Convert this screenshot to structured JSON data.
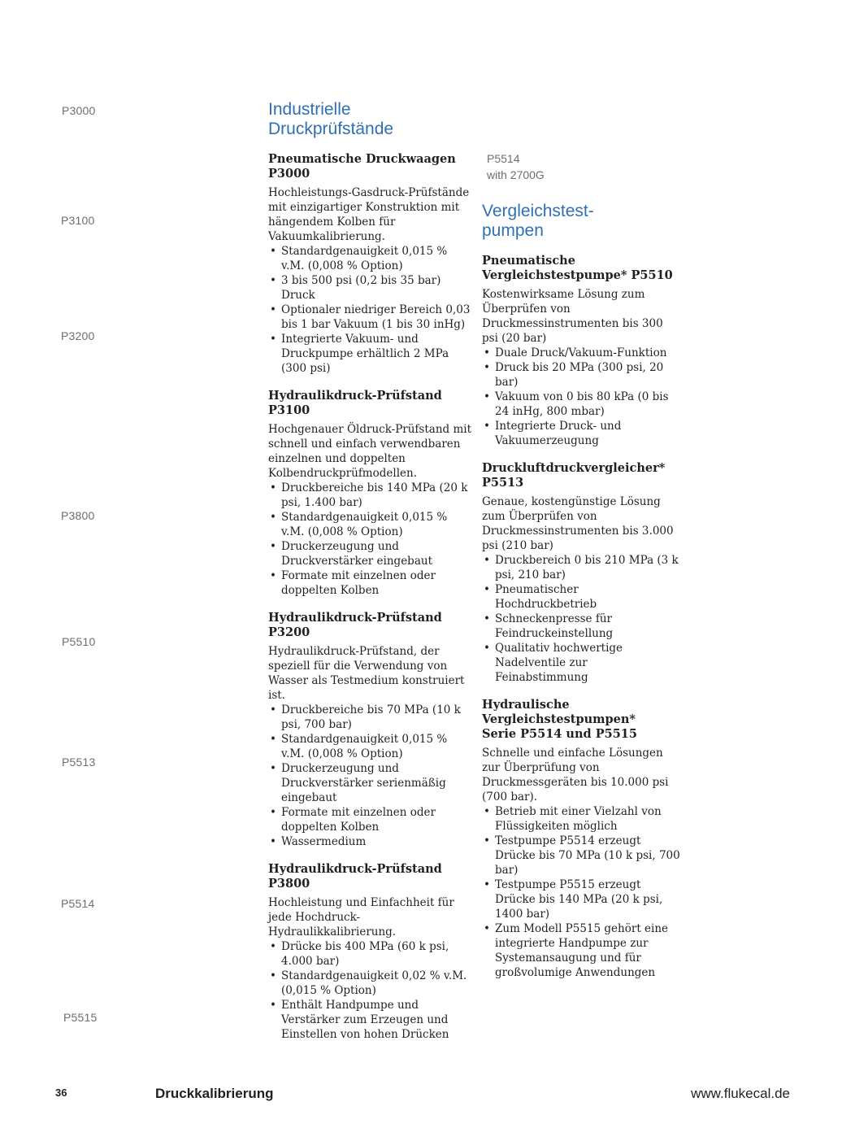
{
  "side_captions": [
    "P3000",
    "P3100",
    "P3200",
    "P3800",
    "P5510",
    "P5513",
    "P5514",
    "P5515"
  ],
  "mid_caption": {
    "line1": "P5514",
    "line2": "with 2700G"
  },
  "section1": {
    "title_line1": "Industrielle",
    "title_line2": "Druckprüfstände",
    "products": [
      {
        "name_line1": "Pneumatische Druckwaagen",
        "name_line2": "P3000",
        "desc": "Hochleistungs-Gasdruck-Prüfstände mit einzigartiger Konstruktion mit hängendem Kolben für Vakuumkalibrierung.",
        "bullets": [
          "Standardgenauigkeit 0,015 % v.M. (0,008 % Option)",
          "3 bis 500 psi (0,2 bis 35 bar) Druck",
          "Optionaler niedriger Bereich 0,03 bis 1 bar Vakuum (1 bis 30 inHg)",
          "Integrierte Vakuum- und Druckpumpe erhältlich 2 MPa (300 psi)"
        ]
      },
      {
        "name_line1": "Hydraulikdruck-Prüfstand",
        "name_line2": "P3100",
        "desc": "Hochgenauer Öldruck-Prüfstand mit schnell und einfach verwendbaren einzelnen und doppelten Kolbendruckprüfmodellen.",
        "bullets": [
          "Druckbereiche bis 140 MPa (20 k psi, 1.400 bar)",
          "Standardgenauigkeit 0,015 % v.M. (0,008 % Option)",
          "Druckerzeugung und Druckverstärker eingebaut",
          "Formate mit einzelnen oder doppelten Kolben"
        ]
      },
      {
        "name_line1": "Hydraulikdruck-Prüfstand",
        "name_line2": "P3200",
        "desc": "Hydraulikdruck-Prüfstand, der speziell für die Verwendung von Wasser als Testmedium konstruiert ist.",
        "bullets": [
          "Druckbereiche bis 70 MPa (10 k psi, 700 bar)",
          "Standardgenauigkeit 0,015 % v.M. (0,008 % Option)",
          "Druckerzeugung und Druckverstärker serienmäßig eingebaut",
          "Formate mit einzelnen oder doppelten Kolben",
          "Wassermedium"
        ]
      },
      {
        "name_line1": "Hydraulikdruck-Prüfstand",
        "name_line2": "P3800",
        "desc": "Hochleistung und Einfachheit für jede Hochdruck-Hydraulikkalibrierung.",
        "bullets": [
          "Drücke bis 400 MPa (60 k psi, 4.000 bar)",
          "Standardgenauigkeit 0,02 % v.M. (0,015 % Option)",
          "Enthält Handpumpe und Verstärker zum Erzeugen und Einstellen von hohen Drücken"
        ]
      }
    ]
  },
  "section2": {
    "title_line1": "Vergleichstest-",
    "title_line2": "pumpen",
    "products": [
      {
        "name_line1": "Pneumatische",
        "name_line2": "Vergleichstestpumpe* P5510",
        "desc": "Kostenwirksame Lösung zum Überprüfen von Druckmessinstrumenten bis 300 psi (20 bar)",
        "bullets": [
          "Duale Druck/Vakuum-Funktion",
          "Druck bis 20 MPa (300 psi, 20 bar)",
          "Vakuum von 0 bis 80 kPa (0 bis 24 inHg, 800 mbar)",
          "Integrierte Druck- und Vakuumerzeugung"
        ]
      },
      {
        "name_line1": "Druckluftdruckvergleicher*",
        "name_line2": "P5513",
        "desc": "Genaue, kostengünstige Lösung zum Überprüfen von Druckmessinstrumenten bis 3.000 psi (210 bar)",
        "bullets": [
          "Druckbereich 0 bis 210 MPa (3 k psi, 210 bar)",
          "Pneumatischer Hochdruckbetrieb",
          "Schneckenpresse für Feindruckeinstellung",
          "Qualitativ hochwertige Nadelventile zur Feinabstimmung"
        ]
      },
      {
        "name_line1": "Hydraulische Vergleichstestpumpen*",
        "name_line2": "Serie P5514 und P5515",
        "desc": "Schnelle und einfache Lösungen zur Überprüfung von Druckmessgeräten bis 10.000 psi (700 bar).",
        "bullets": [
          "Betrieb mit einer Vielzahl von Flüssigkeiten möglich",
          "Testpumpe P5514 erzeugt Drücke bis 70 MPa (10 k psi, 700 bar)",
          "Testpumpe P5515 erzeugt Drücke bis 140 MPa (20 k psi, 1400 bar)",
          "Zum Modell P5515 gehört eine integrierte Handpumpe zur Systemansaugung und für großvolumige Anwendungen"
        ]
      }
    ]
  },
  "footer": {
    "page_number": "36",
    "title": "Druckkalibrierung",
    "url": "www.flukecal.de"
  }
}
